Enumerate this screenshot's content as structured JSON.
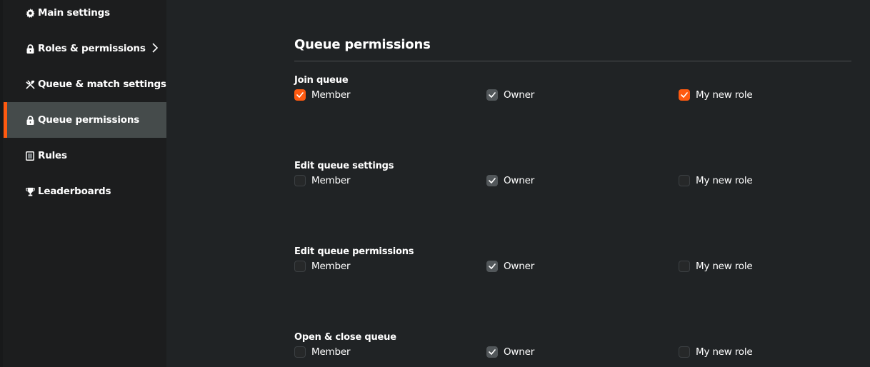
{
  "colors": {
    "accent": "#ff5a10",
    "background": "#202325",
    "sidebar": "#1c1d1e",
    "active_item": "#454b4b",
    "checked_locked": "#52575a"
  },
  "sidebar": {
    "items": [
      {
        "label": "Main settings",
        "icon": "gear-icon",
        "active": false
      },
      {
        "label": "Roles & permissions",
        "icon": "lock-icon",
        "active": false,
        "has_submenu": true
      },
      {
        "label": "Queue & match settings",
        "icon": "tools-icon",
        "active": false
      },
      {
        "label": "Queue permissions",
        "icon": "lock-icon",
        "active": true
      },
      {
        "label": "Rules",
        "icon": "document-icon",
        "active": false
      },
      {
        "label": "Leaderboards",
        "icon": "trophy-icon",
        "active": false
      }
    ]
  },
  "main": {
    "title": "Queue permissions",
    "permissions": [
      {
        "label": "Join queue",
        "options": [
          {
            "label": "Member",
            "checked": true,
            "locked": false
          },
          {
            "label": "Owner",
            "checked": true,
            "locked": true
          },
          {
            "label": "My new role",
            "checked": true,
            "locked": false
          }
        ]
      },
      {
        "label": "Edit queue settings",
        "options": [
          {
            "label": "Member",
            "checked": false,
            "locked": false
          },
          {
            "label": "Owner",
            "checked": true,
            "locked": true
          },
          {
            "label": "My new role",
            "checked": false,
            "locked": false
          }
        ]
      },
      {
        "label": "Edit queue permissions",
        "options": [
          {
            "label": "Member",
            "checked": false,
            "locked": false
          },
          {
            "label": "Owner",
            "checked": true,
            "locked": true
          },
          {
            "label": "My new role",
            "checked": false,
            "locked": false
          }
        ]
      },
      {
        "label": "Open & close queue",
        "options": [
          {
            "label": "Member",
            "checked": false,
            "locked": false
          },
          {
            "label": "Owner",
            "checked": true,
            "locked": true
          },
          {
            "label": "My new role",
            "checked": false,
            "locked": false
          }
        ]
      }
    ]
  }
}
